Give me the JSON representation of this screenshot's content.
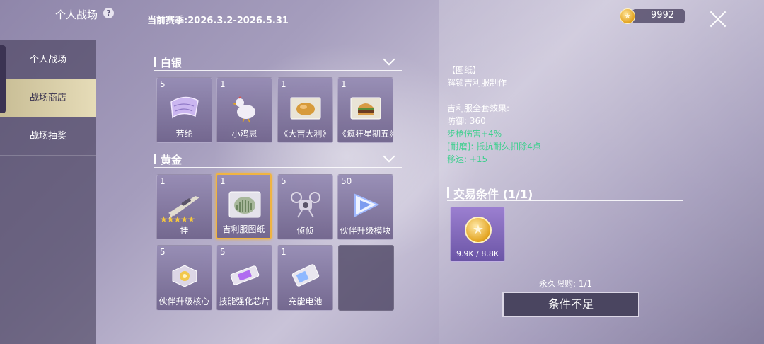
{
  "header": {
    "title": "个人战场",
    "help_icon": "?",
    "season": "当前赛季:2026.3.2-2026.5.31",
    "currency_value": "9992",
    "currency_icon": "coin-icon"
  },
  "sidebar": {
    "items": [
      {
        "label": "个人战场",
        "active": false
      },
      {
        "label": "战场商店",
        "active": true
      },
      {
        "label": "战场抽奖",
        "active": false
      }
    ]
  },
  "sections": [
    {
      "title": "白银",
      "items": [
        {
          "qty": "5",
          "name": "芳纶",
          "icon": "fabric-icon"
        },
        {
          "qty": "1",
          "name": "小鸡崽",
          "icon": "chicken-icon"
        },
        {
          "qty": "1",
          "name": "《大吉大利》",
          "icon": "chicken-dinner-blueprint-icon"
        },
        {
          "qty": "1",
          "name": "《疯狂星期五》",
          "icon": "burger-blueprint-icon"
        }
      ]
    },
    {
      "title": "黄金",
      "items": [
        {
          "qty": "1",
          "name": "挂",
          "icon": "sniper-rifle-icon",
          "stars": "★★★★★"
        },
        {
          "qty": "1",
          "name": "吉利服图纸",
          "icon": "ghillie-suit-icon",
          "selected": true
        },
        {
          "qty": "5",
          "name": "侦侦",
          "icon": "drone-icon"
        },
        {
          "qty": "50",
          "name": "伙伴升级模块",
          "icon": "module-icon"
        },
        {
          "qty": "5",
          "name": "伙伴升级核心",
          "icon": "core-icon"
        },
        {
          "qty": "5",
          "name": "技能强化芯片",
          "icon": "chip-icon"
        },
        {
          "qty": "1",
          "name": "充能电池",
          "icon": "battery-icon"
        }
      ]
    }
  ],
  "detail": {
    "tag": "【图纸】",
    "desc": "解锁吉利服制作",
    "set_title": "吉利服全套效果:",
    "defense": "防御:  360",
    "rifle_damage": "步枪伤害+4%",
    "durability": "[耐磨]:  抵抗耐久扣除4点",
    "speed": "移速:  +15"
  },
  "trade": {
    "title": "交易条件 (1/1)",
    "cost": "9.9K / 8.8K",
    "cost_icon": "coin-icon",
    "limit": "永久限购:  1/1",
    "button": "条件不足"
  },
  "colors": {
    "selected_border": "#f0b441",
    "bonus_text": "#3ecf8e",
    "sidebar_active": "#e6dcb8"
  }
}
